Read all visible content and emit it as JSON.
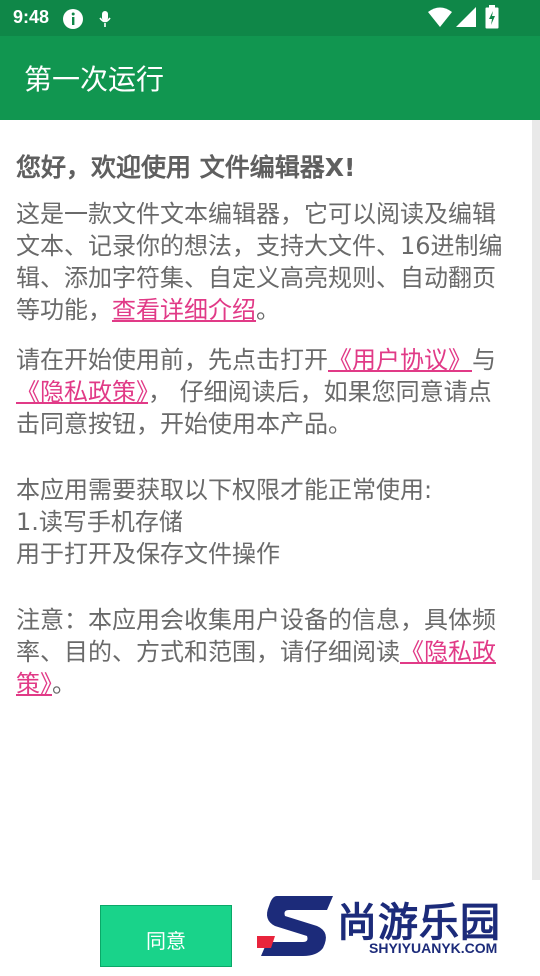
{
  "status_bar": {
    "time": "9:48",
    "icons": [
      "info-icon",
      "mic-icon",
      "wifi-icon",
      "signal-icon",
      "battery-charging-icon"
    ]
  },
  "app_bar": {
    "title": "第一次运行"
  },
  "content": {
    "welcome": "您好，欢迎使用 文件编辑器X!",
    "intro_text": "这是一款文件文本编辑器，它可以阅读及编辑文本、记录你的想法，支持大文件、16进制编辑、添加字符集、自定义高亮规则、自动翻页等功能，",
    "intro_link": "查看详细介绍",
    "intro_end": "。",
    "consent_prefix": "请在开始使用前，先点击打开",
    "user_agreement_link": "《用户协议》",
    "consent_and": "与",
    "privacy_link_1": "《隐私政策》",
    "consent_suffix": "， 仔细阅读后，如果您同意请点击同意按钮，开始使用本产品。",
    "permission_title": "本应用需要获取以下权限才能正常使用:",
    "permission_item": "1.读写手机存储",
    "permission_desc": "用于打开及保存文件操作",
    "notice_text": "注意：本应用会收集用户设备的信息，具体频率、目的、方式和范围，请仔细阅读",
    "privacy_link_2": "《隐私政策》",
    "notice_end": "。"
  },
  "agree_button": {
    "label": "同意"
  },
  "watermark": {
    "cn": "尚游乐园",
    "en": "SHYIYUANYK.COM"
  },
  "colors": {
    "status_bar": "#0f8748",
    "app_bar": "#119650",
    "link": "#e13a87",
    "button": "#19d38a"
  }
}
